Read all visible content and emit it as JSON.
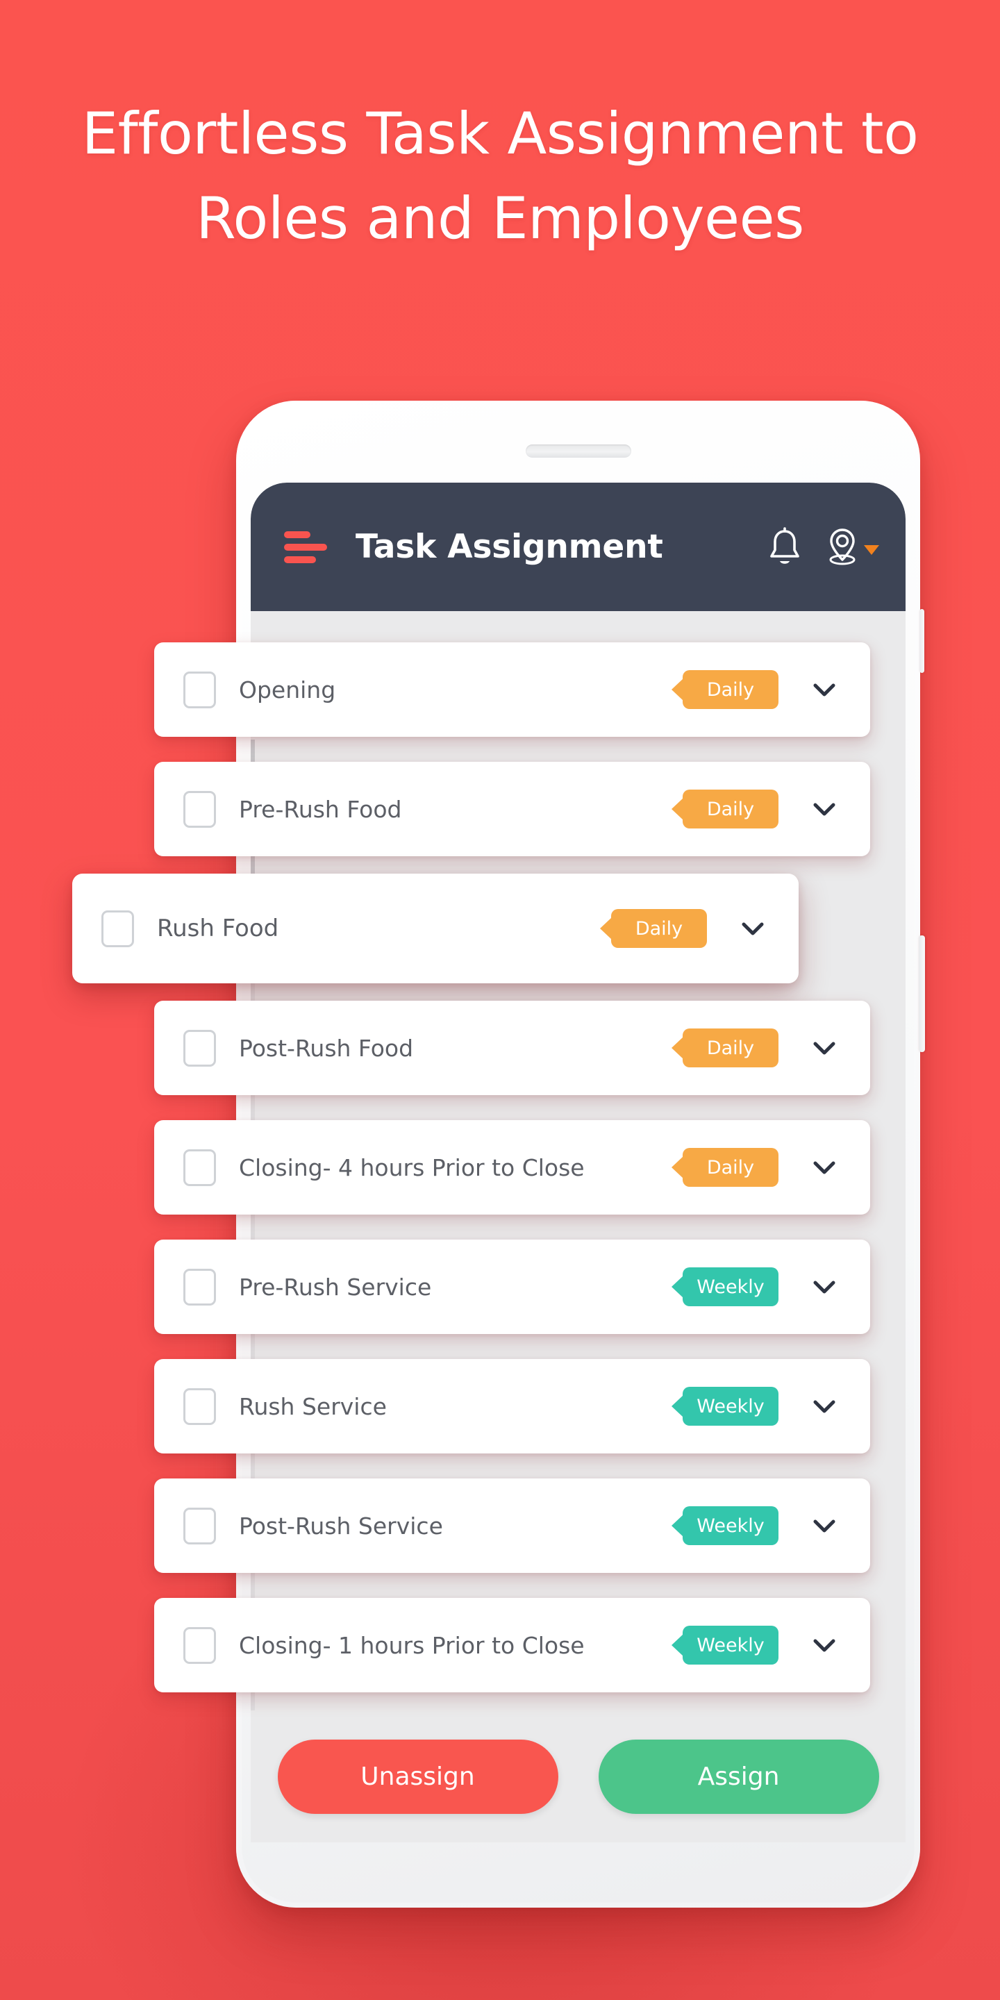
{
  "page": {
    "background_color": "#FA5252",
    "headline": "Effortless Task Assignment to Roles and Employees"
  },
  "phone": {
    "speaker_label": "earpiece-speaker"
  },
  "appbar": {
    "menu_label": "menu",
    "title": "Task Assignment",
    "bell_label": "notifications",
    "location_label": "location",
    "caret_label": "dropdown"
  },
  "colors": {
    "background_red": "#FA5252",
    "appbar_navy": "#3D4455",
    "menu_red": "#F9544F",
    "screen_grey": "#EAEAEB",
    "card_white": "#FFFFFF",
    "tag_daily_orange": "#F7A945",
    "tag_weekly_teal": "#33C6AC",
    "btn_unassign_red": "#F9564F",
    "btn_assign_green": "#4CC58A",
    "task_text_grey": "#5C5F66",
    "checkbox_border": "#CFD2D6",
    "caret_orange": "#F2821E"
  },
  "tasks": [
    {
      "name": "Opening",
      "tag": "Daily",
      "tag_type": "daily",
      "checked": false,
      "elevated": false
    },
    {
      "name": "Pre-Rush Food",
      "tag": "Daily",
      "tag_type": "daily",
      "checked": false,
      "elevated": false
    },
    {
      "name": "Rush Food",
      "tag": "Daily",
      "tag_type": "daily",
      "checked": false,
      "elevated": true
    },
    {
      "name": "Post-Rush Food",
      "tag": "Daily",
      "tag_type": "daily",
      "checked": false,
      "elevated": false
    },
    {
      "name": "Closing- 4 hours Prior to Close",
      "tag": "Daily",
      "tag_type": "daily",
      "checked": false,
      "elevated": false
    },
    {
      "name": "Pre-Rush Service",
      "tag": "Weekly",
      "tag_type": "weekly",
      "checked": false,
      "elevated": false
    },
    {
      "name": "Rush Service",
      "tag": "Weekly",
      "tag_type": "weekly",
      "checked": false,
      "elevated": false
    },
    {
      "name": "Post-Rush Service",
      "tag": "Weekly",
      "tag_type": "weekly",
      "checked": false,
      "elevated": false
    },
    {
      "name": "Closing- 1 hours Prior to Close",
      "tag": "Weekly",
      "tag_type": "weekly",
      "checked": false,
      "elevated": false
    }
  ],
  "actions": {
    "unassign_label": "Unassign",
    "assign_label": "Assign"
  }
}
